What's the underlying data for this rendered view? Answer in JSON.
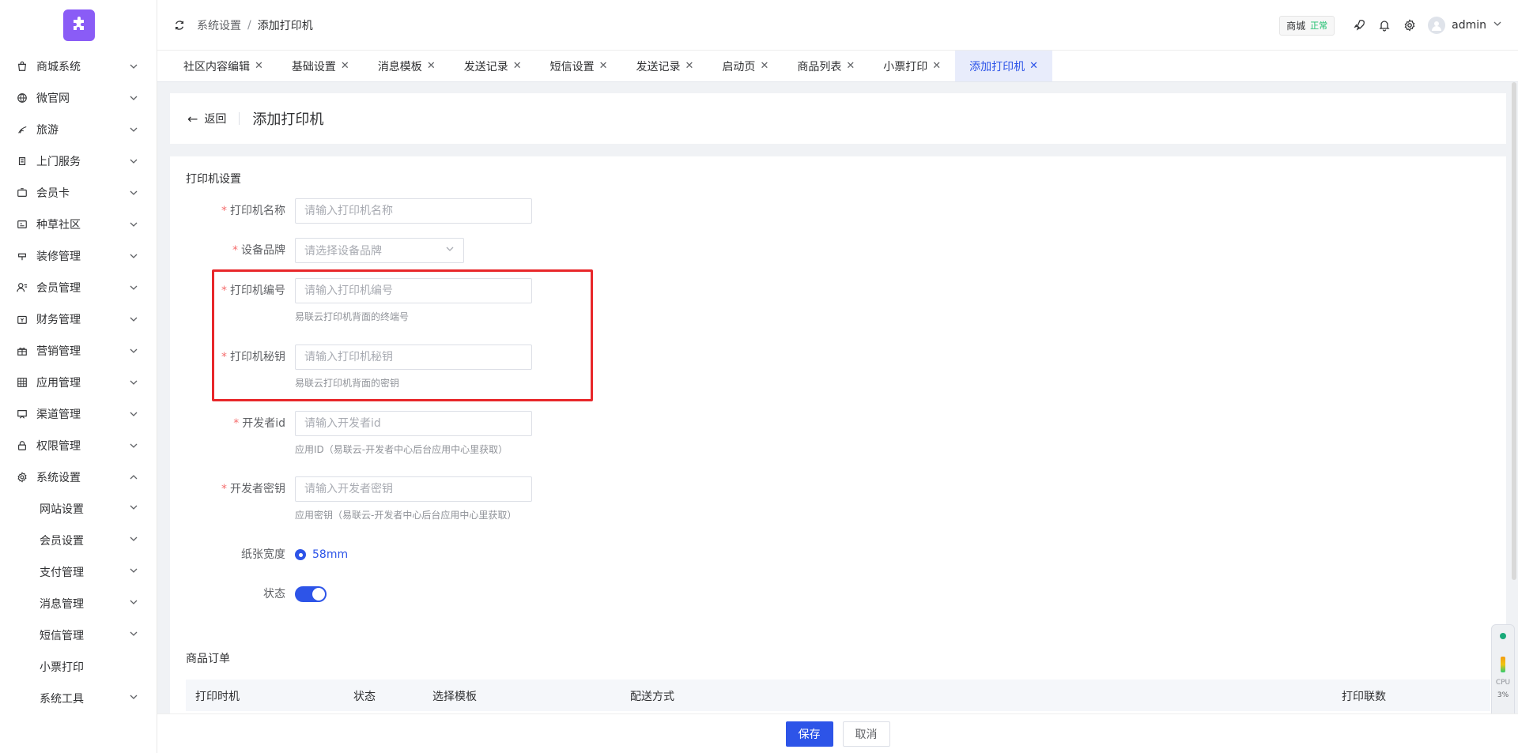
{
  "sidebar": {
    "items": [
      {
        "label": "商城系统",
        "icon": "bag-icon"
      },
      {
        "label": "微官网",
        "icon": "globe-icon"
      },
      {
        "label": "旅游",
        "icon": "travel-icon"
      },
      {
        "label": "上门服务",
        "icon": "service-icon"
      },
      {
        "label": "会员卡",
        "icon": "card-icon"
      },
      {
        "label": "种草社区",
        "icon": "community-icon"
      },
      {
        "label": "装修管理",
        "icon": "decor-icon"
      },
      {
        "label": "会员管理",
        "icon": "user-icon"
      },
      {
        "label": "财务管理",
        "icon": "finance-icon"
      },
      {
        "label": "营销管理",
        "icon": "gift-icon"
      },
      {
        "label": "应用管理",
        "icon": "apps-icon"
      },
      {
        "label": "渠道管理",
        "icon": "channel-icon"
      },
      {
        "label": "权限管理",
        "icon": "lock-icon"
      },
      {
        "label": "系统设置",
        "icon": "gear-icon"
      }
    ],
    "subitems": [
      {
        "label": "网站设置",
        "chevron": true
      },
      {
        "label": "会员设置",
        "chevron": true
      },
      {
        "label": "支付管理",
        "chevron": true
      },
      {
        "label": "消息管理",
        "chevron": true
      },
      {
        "label": "短信管理",
        "chevron": true
      },
      {
        "label": "小票打印",
        "chevron": false
      },
      {
        "label": "系统工具",
        "chevron": true
      }
    ]
  },
  "header": {
    "breadcrumb": [
      "系统设置",
      "添加打印机"
    ],
    "separator": "/",
    "shop": "商城",
    "shop_status": "正常",
    "user": "admin"
  },
  "tabs": [
    {
      "label": "社区内容编辑",
      "active": false
    },
    {
      "label": "基础设置",
      "active": false
    },
    {
      "label": "消息模板",
      "active": false
    },
    {
      "label": "发送记录",
      "active": false
    },
    {
      "label": "短信设置",
      "active": false
    },
    {
      "label": "发送记录",
      "active": false
    },
    {
      "label": "启动页",
      "active": false
    },
    {
      "label": "商品列表",
      "active": false
    },
    {
      "label": "小票打印",
      "active": false
    },
    {
      "label": "添加打印机",
      "active": true
    }
  ],
  "page": {
    "back": "返回",
    "title": "添加打印机"
  },
  "form": {
    "section": "打印机设置",
    "name_label": "打印机名称",
    "name_placeholder": "请输入打印机名称",
    "brand_label": "设备品牌",
    "brand_placeholder": "请选择设备品牌",
    "sn_label": "打印机编号",
    "sn_placeholder": "请输入打印机编号",
    "sn_hint": "易联云打印机背面的终端号",
    "key_label": "打印机秘钥",
    "key_placeholder": "请输入打印机秘钥",
    "key_hint": "易联云打印机背面的密钥",
    "dev_id_label": "开发者id",
    "dev_id_placeholder": "请输入开发者id",
    "dev_id_hint": "应用ID（易联云-开发者中心后台应用中心里获取）",
    "dev_key_label": "开发者密钥",
    "dev_key_placeholder": "请输入开发者密钥",
    "dev_key_hint": "应用密钥（易联云-开发者中心后台应用中心里获取）",
    "paper_label": "纸张宽度",
    "paper_value": "58mm",
    "status_label": "状态",
    "status_on": true
  },
  "orders": {
    "section": "商品订单",
    "columns": [
      "打印时机",
      "状态",
      "选择模板",
      "配送方式",
      "打印联数"
    ]
  },
  "footer": {
    "save": "保存",
    "cancel": "取消"
  },
  "cpu": {
    "label": "CPU",
    "percent": "3%"
  },
  "colors": {
    "primary": "#2d54e8",
    "highlight": "#e8272a",
    "logo": "#8a5cf6"
  }
}
